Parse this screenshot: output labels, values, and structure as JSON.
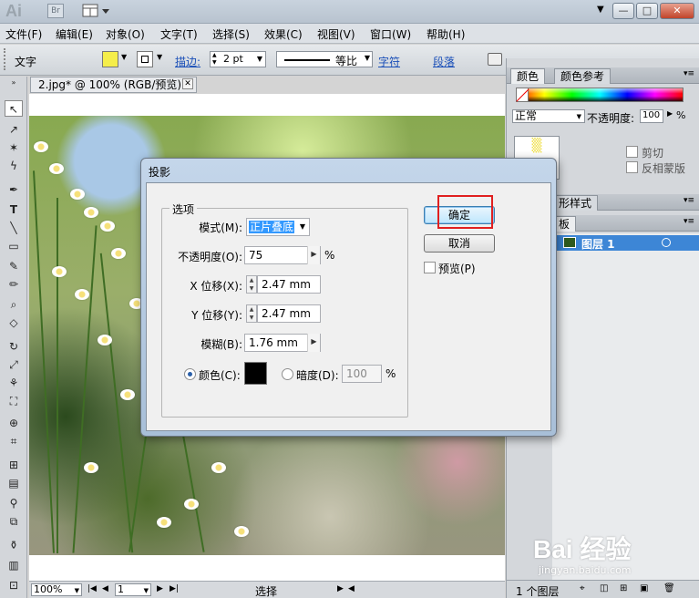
{
  "app": {
    "logo": "Ai",
    "bridge_label": "Br",
    "minimize": "—",
    "restore": "□",
    "close": "✕",
    "workspace_arrow": "▼"
  },
  "menu": [
    "文件(F)",
    "编辑(E)",
    "对象(O)",
    "文字(T)",
    "选择(S)",
    "效果(C)",
    "视图(V)",
    "窗口(W)",
    "帮助(H)"
  ],
  "control_bar": {
    "selection_type": "文字",
    "stroke_label": "描边:",
    "stroke_weight": "2 pt",
    "stroke_style": "等比",
    "character_link": "字符",
    "paragraph_link": "段落",
    "fill_color": "#f5ee4a"
  },
  "document": {
    "tab_title": "2.jpg* @ 100% (RGB/预览)",
    "tab_close": "✕"
  },
  "status_bar": {
    "zoom": "100%",
    "artboard": "1",
    "status_text": "选择"
  },
  "panels": {
    "color_tab": "颜色",
    "color_guide_tab": "颜色参考",
    "blend_mode": "正常",
    "opacity_label": "不透明度:",
    "opacity_value": "100",
    "clip_label": "剪切",
    "invert_mask_label": "反相蒙版",
    "graphic_styles_tab": "形样式",
    "layers_tab": "板",
    "layer_name": "图层 1",
    "layer_count": "1 个图层"
  },
  "dialog": {
    "title": "投影",
    "group_label": "选项",
    "mode_label": "模式(M):",
    "mode_value": "正片叠底",
    "opacity_label": "不透明度(O):",
    "opacity_value": "75",
    "percent": "%",
    "x_offset_label": "X 位移(X):",
    "x_offset_value": "2.47 mm",
    "y_offset_label": "Y 位移(Y):",
    "y_offset_value": "2.47 mm",
    "blur_label": "模糊(B):",
    "blur_value": "1.76 mm",
    "color_label": "颜色(C):",
    "shadow_color": "#000000",
    "darkness_label": "暗度(D):",
    "darkness_value": "100",
    "ok_label": "确定",
    "cancel_label": "取消",
    "preview_label": "预览(P)"
  },
  "watermark": {
    "text": "Bai 经验",
    "url": "jingyan.baidu.com"
  }
}
